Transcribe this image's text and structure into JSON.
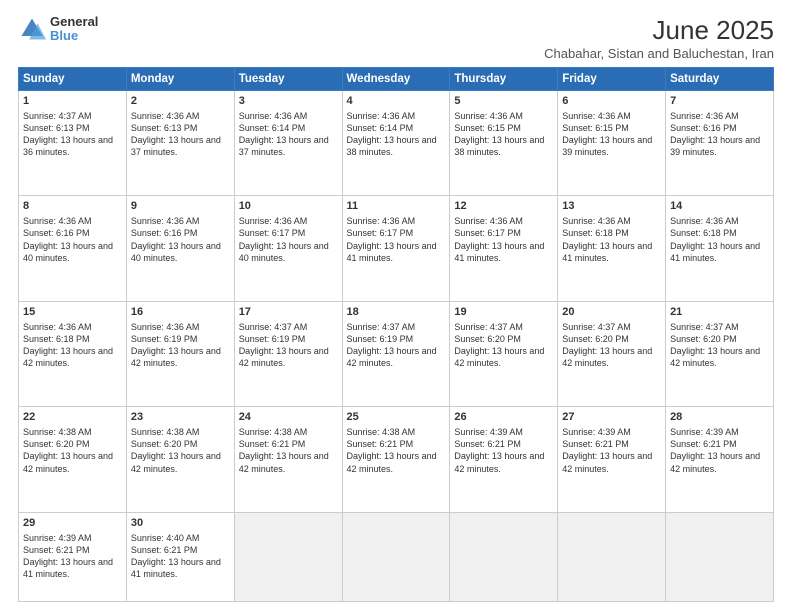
{
  "header": {
    "logo_line1": "General",
    "logo_line2": "Blue",
    "month": "June 2025",
    "location": "Chabahar, Sistan and Baluchestan, Iran"
  },
  "weekdays": [
    "Sunday",
    "Monday",
    "Tuesday",
    "Wednesday",
    "Thursday",
    "Friday",
    "Saturday"
  ],
  "weeks": [
    [
      {
        "day": "1",
        "info": "Sunrise: 4:37 AM\nSunset: 6:13 PM\nDaylight: 13 hours and 36 minutes."
      },
      {
        "day": "2",
        "info": "Sunrise: 4:36 AM\nSunset: 6:13 PM\nDaylight: 13 hours and 37 minutes."
      },
      {
        "day": "3",
        "info": "Sunrise: 4:36 AM\nSunset: 6:14 PM\nDaylight: 13 hours and 37 minutes."
      },
      {
        "day": "4",
        "info": "Sunrise: 4:36 AM\nSunset: 6:14 PM\nDaylight: 13 hours and 38 minutes."
      },
      {
        "day": "5",
        "info": "Sunrise: 4:36 AM\nSunset: 6:15 PM\nDaylight: 13 hours and 38 minutes."
      },
      {
        "day": "6",
        "info": "Sunrise: 4:36 AM\nSunset: 6:15 PM\nDaylight: 13 hours and 39 minutes."
      },
      {
        "day": "7",
        "info": "Sunrise: 4:36 AM\nSunset: 6:16 PM\nDaylight: 13 hours and 39 minutes."
      }
    ],
    [
      {
        "day": "8",
        "info": "Sunrise: 4:36 AM\nSunset: 6:16 PM\nDaylight: 13 hours and 40 minutes."
      },
      {
        "day": "9",
        "info": "Sunrise: 4:36 AM\nSunset: 6:16 PM\nDaylight: 13 hours and 40 minutes."
      },
      {
        "day": "10",
        "info": "Sunrise: 4:36 AM\nSunset: 6:17 PM\nDaylight: 13 hours and 40 minutes."
      },
      {
        "day": "11",
        "info": "Sunrise: 4:36 AM\nSunset: 6:17 PM\nDaylight: 13 hours and 41 minutes."
      },
      {
        "day": "12",
        "info": "Sunrise: 4:36 AM\nSunset: 6:17 PM\nDaylight: 13 hours and 41 minutes."
      },
      {
        "day": "13",
        "info": "Sunrise: 4:36 AM\nSunset: 6:18 PM\nDaylight: 13 hours and 41 minutes."
      },
      {
        "day": "14",
        "info": "Sunrise: 4:36 AM\nSunset: 6:18 PM\nDaylight: 13 hours and 41 minutes."
      }
    ],
    [
      {
        "day": "15",
        "info": "Sunrise: 4:36 AM\nSunset: 6:18 PM\nDaylight: 13 hours and 42 minutes."
      },
      {
        "day": "16",
        "info": "Sunrise: 4:36 AM\nSunset: 6:19 PM\nDaylight: 13 hours and 42 minutes."
      },
      {
        "day": "17",
        "info": "Sunrise: 4:37 AM\nSunset: 6:19 PM\nDaylight: 13 hours and 42 minutes."
      },
      {
        "day": "18",
        "info": "Sunrise: 4:37 AM\nSunset: 6:19 PM\nDaylight: 13 hours and 42 minutes."
      },
      {
        "day": "19",
        "info": "Sunrise: 4:37 AM\nSunset: 6:20 PM\nDaylight: 13 hours and 42 minutes."
      },
      {
        "day": "20",
        "info": "Sunrise: 4:37 AM\nSunset: 6:20 PM\nDaylight: 13 hours and 42 minutes."
      },
      {
        "day": "21",
        "info": "Sunrise: 4:37 AM\nSunset: 6:20 PM\nDaylight: 13 hours and 42 minutes."
      }
    ],
    [
      {
        "day": "22",
        "info": "Sunrise: 4:38 AM\nSunset: 6:20 PM\nDaylight: 13 hours and 42 minutes."
      },
      {
        "day": "23",
        "info": "Sunrise: 4:38 AM\nSunset: 6:20 PM\nDaylight: 13 hours and 42 minutes."
      },
      {
        "day": "24",
        "info": "Sunrise: 4:38 AM\nSunset: 6:21 PM\nDaylight: 13 hours and 42 minutes."
      },
      {
        "day": "25",
        "info": "Sunrise: 4:38 AM\nSunset: 6:21 PM\nDaylight: 13 hours and 42 minutes."
      },
      {
        "day": "26",
        "info": "Sunrise: 4:39 AM\nSunset: 6:21 PM\nDaylight: 13 hours and 42 minutes."
      },
      {
        "day": "27",
        "info": "Sunrise: 4:39 AM\nSunset: 6:21 PM\nDaylight: 13 hours and 42 minutes."
      },
      {
        "day": "28",
        "info": "Sunrise: 4:39 AM\nSunset: 6:21 PM\nDaylight: 13 hours and 42 minutes."
      }
    ],
    [
      {
        "day": "29",
        "info": "Sunrise: 4:39 AM\nSunset: 6:21 PM\nDaylight: 13 hours and 41 minutes."
      },
      {
        "day": "30",
        "info": "Sunrise: 4:40 AM\nSunset: 6:21 PM\nDaylight: 13 hours and 41 minutes."
      },
      {
        "day": "",
        "info": ""
      },
      {
        "day": "",
        "info": ""
      },
      {
        "day": "",
        "info": ""
      },
      {
        "day": "",
        "info": ""
      },
      {
        "day": "",
        "info": ""
      }
    ]
  ]
}
